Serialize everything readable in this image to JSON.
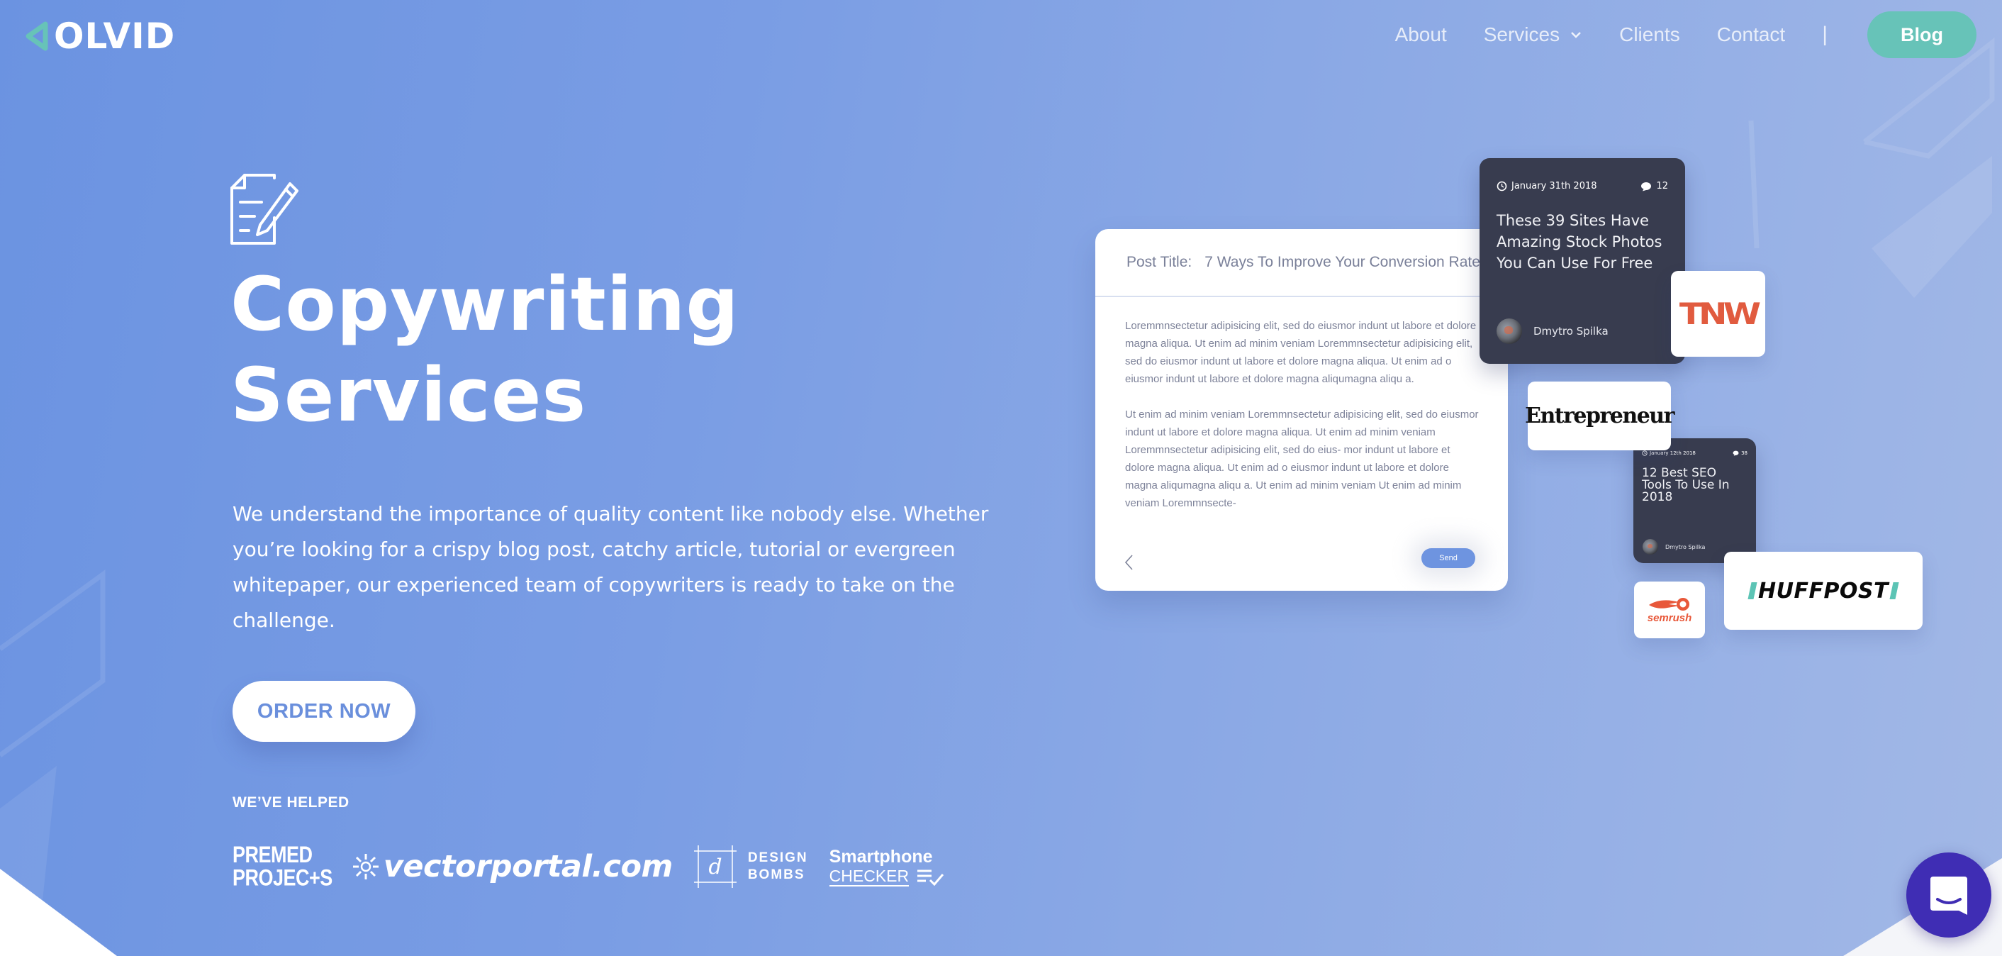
{
  "brand": {
    "logo_text": "OLVID",
    "accent_color": "#67c3b8",
    "chat_color": "#3f2db4"
  },
  "nav": {
    "items": [
      {
        "label": "About"
      },
      {
        "label": "Services",
        "has_dropdown": true
      },
      {
        "label": "Clients"
      },
      {
        "label": "Contact"
      }
    ],
    "separator": "|",
    "cta_label": "Blog"
  },
  "hero": {
    "icon": "document-pencil-icon",
    "title_line1": "Copywriting",
    "title_line2": "Services",
    "description": "We understand the importance of quality content like nobody else. Whether you’re looking for a crispy blog post, catchy article, tutorial or evergreen whitepaper, our experienced team of copywriters is ready to take on the challenge.",
    "cta_label": "ORDER NOW",
    "helped_label": "WE’VE HELPED",
    "clients": {
      "premed_line1": "PREMED",
      "premed_line2": "PROJEC+S",
      "vectorportal": "vectorportal.com",
      "designbombs_line1": "DESIGN",
      "designbombs_line2": "BOMBS",
      "smartphone_line1": "Smartphone",
      "smartphone_line2": "CHECKER"
    }
  },
  "editor": {
    "post_title_label": "Post Title:",
    "post_title_value": "7 Ways To Improve Your Conversion Rate",
    "paragraph1": "Loremmnsectetur adipisicing elit, sed do eiusmor indunt ut labore et dolore magna aliqua. Ut enim ad minim veniam Loremmnsectetur adipisicing elit, sed do eiusmor indunt ut labore et dolore magna aliqua. Ut enim ad o eiusmor indunt ut labore et dolore magna aliqumagna aliqu a.",
    "paragraph2": "Ut enim ad minim veniam Loremmnsectetur adipisicing elit, sed do eiusmor indunt ut labore et dolore magna aliqua. Ut enim ad minim veniam Loremmnsectetur adipisicing elit, sed do eius- mor indunt ut labore et dolore magna aliqua. Ut enim ad o eiusmor indunt ut labore et dolore magna aliqumagna aliqu a. Ut enim ad minim veniam Ut enim ad minim veniam Loremmnsecte-",
    "send_label": "Send"
  },
  "blog_cards": [
    {
      "date": "January 31th 2018",
      "comments": "12",
      "title": "These 39 Sites Have Amazing Stock Photos You Can Use For Free",
      "author": "Dmytro Spilka"
    },
    {
      "date": "January 12th 2018",
      "comments": "38",
      "title": "12 Best SEO Tools To Use In 2018",
      "author": "Dmytro Spilka"
    }
  ],
  "publications": {
    "tnw": "TNW",
    "entrepreneur": "Entrepreneur",
    "semrush": "semrush",
    "huffpost": "HUFFPOST"
  }
}
